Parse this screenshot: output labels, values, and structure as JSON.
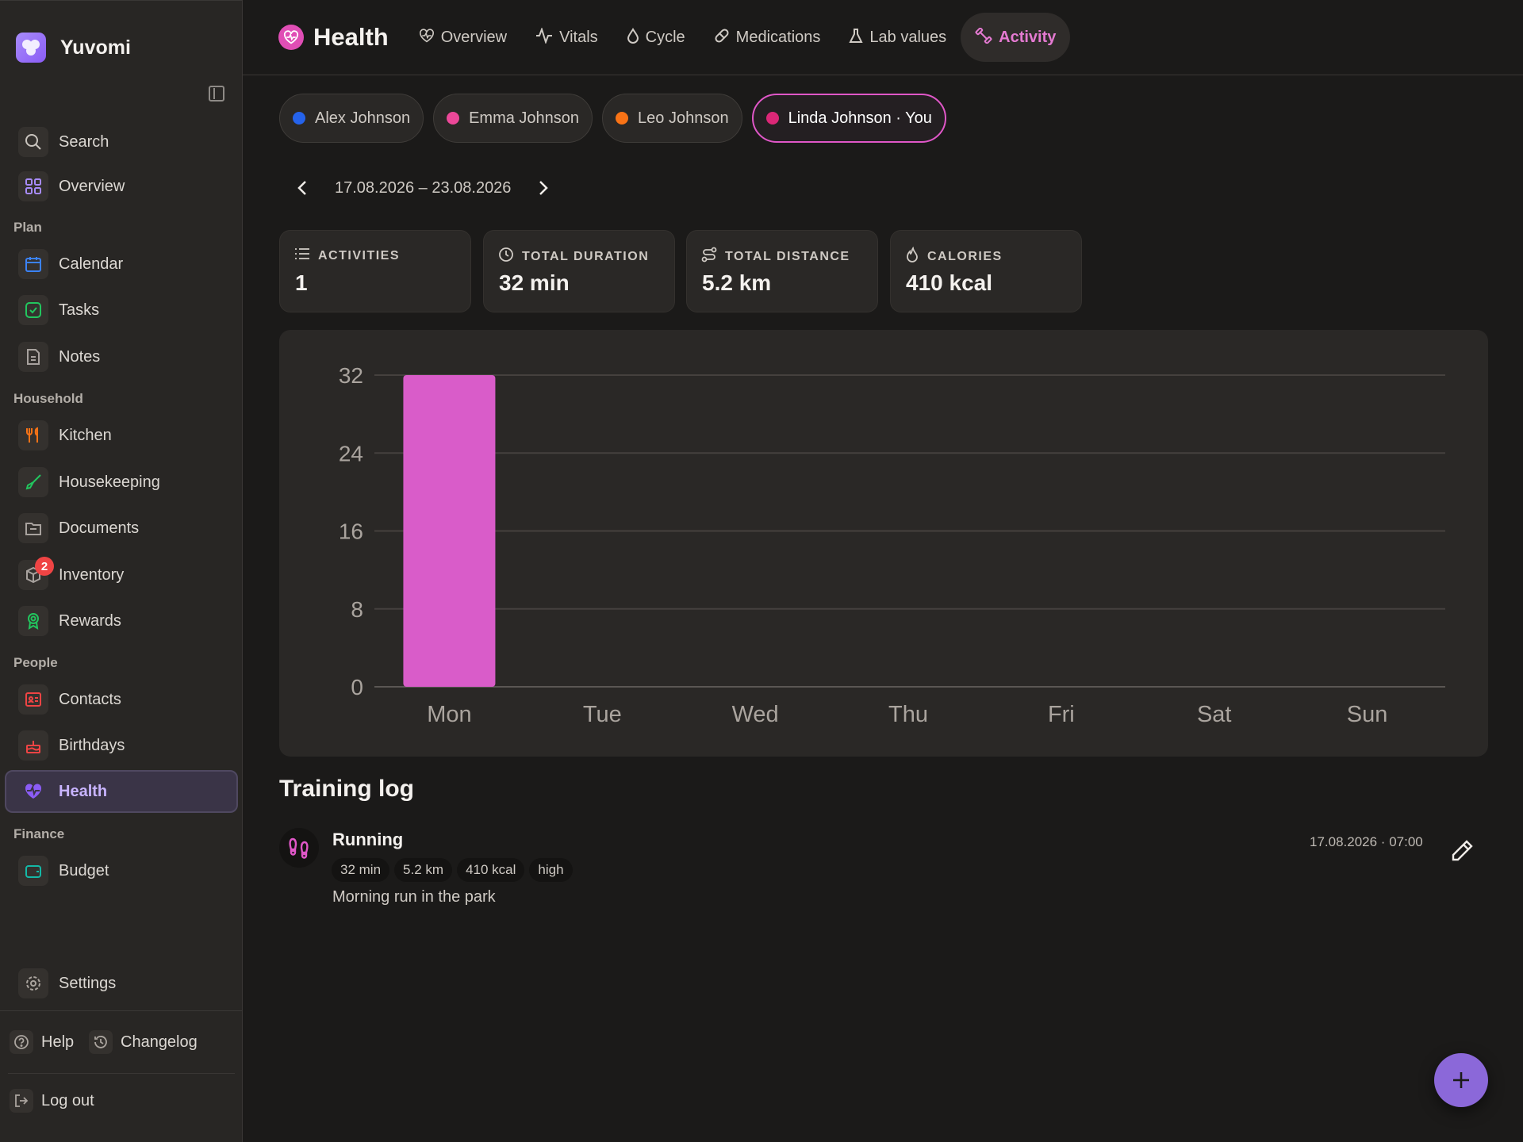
{
  "app": {
    "name": "Yuvomi"
  },
  "sidebar": {
    "top_items": [
      {
        "label": "Search",
        "icon": "search-icon"
      },
      {
        "label": "Overview",
        "icon": "grid-icon"
      }
    ],
    "sections": [
      {
        "label": "Plan",
        "items": [
          {
            "label": "Calendar",
            "icon": "calendar-icon",
            "color": "#3b82f6"
          },
          {
            "label": "Tasks",
            "icon": "check-square-icon",
            "color": "#22c55e"
          },
          {
            "label": "Notes",
            "icon": "note-icon",
            "color": "#a8a29e"
          }
        ]
      },
      {
        "label": "Household",
        "items": [
          {
            "label": "Kitchen",
            "icon": "utensils-icon",
            "color": "#f97316"
          },
          {
            "label": "Housekeeping",
            "icon": "broom-icon",
            "color": "#22c55e"
          },
          {
            "label": "Documents",
            "icon": "folder-icon",
            "color": "#a8a29e"
          },
          {
            "label": "Inventory",
            "icon": "box-icon",
            "color": "#a8a29e",
            "badge": "2"
          },
          {
            "label": "Rewards",
            "icon": "award-icon",
            "color": "#22c55e"
          }
        ]
      },
      {
        "label": "People",
        "items": [
          {
            "label": "Contacts",
            "icon": "contact-card-icon",
            "color": "#ef4444"
          },
          {
            "label": "Birthdays",
            "icon": "cake-icon",
            "color": "#ef4444"
          },
          {
            "label": "Health",
            "icon": "heart-pulse-icon",
            "color": "#a78bfa",
            "active": true
          }
        ]
      },
      {
        "label": "Finance",
        "items": [
          {
            "label": "Budget",
            "icon": "wallet-icon",
            "color": "#14b8a6"
          }
        ]
      }
    ],
    "settings_label": "Settings",
    "help_label": "Help",
    "changelog_label": "Changelog",
    "logout_label": "Log out"
  },
  "header": {
    "title": "Health",
    "tabs": [
      {
        "label": "Overview",
        "icon": "heart-pulse-icon"
      },
      {
        "label": "Vitals",
        "icon": "activity-icon"
      },
      {
        "label": "Cycle",
        "icon": "droplet-icon"
      },
      {
        "label": "Medications",
        "icon": "pill-icon"
      },
      {
        "label": "Lab values",
        "icon": "flask-icon"
      },
      {
        "label": "Activity",
        "icon": "dumbbell-icon",
        "active": true
      }
    ]
  },
  "people": [
    {
      "name": "Alex Johnson",
      "color": "#2563eb"
    },
    {
      "name": "Emma Johnson",
      "color": "#ec4899"
    },
    {
      "name": "Leo Johnson",
      "color": "#f97316"
    },
    {
      "name": "Linda Johnson · You",
      "color": "#db2777",
      "active": true
    }
  ],
  "date_range": "17.08.2026 – 23.08.2026",
  "stats": [
    {
      "label": "ACTIVITIES",
      "value": "1",
      "icon": "list-icon"
    },
    {
      "label": "TOTAL DURATION",
      "value": "32 min",
      "icon": "clock-icon"
    },
    {
      "label": "TOTAL DISTANCE",
      "value": "5.2 km",
      "icon": "route-icon"
    },
    {
      "label": "CALORIES",
      "value": "410 kcal",
      "icon": "flame-icon"
    }
  ],
  "chart_data": {
    "type": "bar",
    "categories": [
      "Mon",
      "Tue",
      "Wed",
      "Thu",
      "Fri",
      "Sat",
      "Sun"
    ],
    "values": [
      32,
      0,
      0,
      0,
      0,
      0,
      0
    ],
    "yticks": [
      0,
      8,
      16,
      24,
      32
    ],
    "ylim": [
      0,
      32
    ],
    "bar_color": "#d95cc9",
    "grid": true
  },
  "training_log": {
    "title": "Training log",
    "entries": [
      {
        "title": "Running",
        "icon": "footprints-icon",
        "chips": [
          "32 min",
          "5.2 km",
          "410 kcal",
          "high"
        ],
        "description": "Morning run in the park",
        "datetime": "17.08.2026 · 07:00"
      }
    ]
  },
  "fab": {
    "label": "+"
  }
}
